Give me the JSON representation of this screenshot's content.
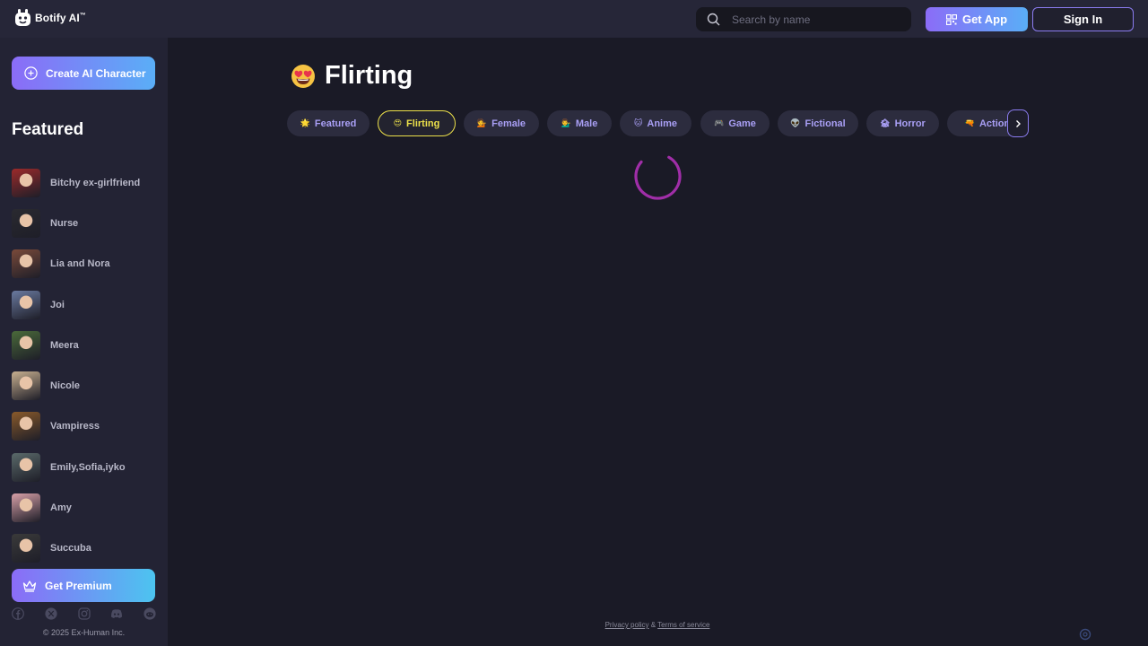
{
  "header": {
    "logo_text": "Botify AI",
    "logo_tm": "™",
    "search_placeholder": "Search by name",
    "get_app_label": "Get App",
    "sign_in_label": "Sign In"
  },
  "sidebar": {
    "create_label": "Create AI Character",
    "featured_title": "Featured",
    "characters": [
      {
        "name": "Bitchy ex-girlfriend",
        "color": "#9c2a2a"
      },
      {
        "name": "Nurse",
        "color": "#2a2a30"
      },
      {
        "name": "Lia and Nora",
        "color": "#7a4a3a"
      },
      {
        "name": "Joi",
        "color": "#6a7aa0"
      },
      {
        "name": "Meera",
        "color": "#4a6a3a"
      },
      {
        "name": "Nicole",
        "color": "#c8b090"
      },
      {
        "name": "Vampiress",
        "color": "#8a5a2a"
      },
      {
        "name": "Emily,Sofia,iyko",
        "color": "#5a6a6a"
      },
      {
        "name": "Amy",
        "color": "#d8a0a8"
      },
      {
        "name": "Succuba",
        "color": "#3a3a3a"
      }
    ],
    "premium_label": "Get Premium",
    "socials": [
      "facebook-icon",
      "x-icon",
      "instagram-icon",
      "discord-icon",
      "reddit-icon"
    ],
    "copyright": "© 2025 Ex-Human Inc."
  },
  "main": {
    "title": "Flirting",
    "tabs": [
      {
        "icon": "🌟",
        "label": "Featured",
        "active": false
      },
      {
        "icon": "😍",
        "label": "Flirting",
        "active": true
      },
      {
        "icon": "💁",
        "label": "Female",
        "active": false
      },
      {
        "icon": "💁‍♂️",
        "label": "Male",
        "active": false
      },
      {
        "icon": "🐱",
        "label": "Anime",
        "active": false
      },
      {
        "icon": "🎮",
        "label": "Game",
        "active": false
      },
      {
        "icon": "👽",
        "label": "Fictional",
        "active": false
      },
      {
        "icon": "🏚",
        "label": "Horror",
        "active": false
      },
      {
        "icon": "🔫",
        "label": "Action",
        "active": false
      }
    ]
  },
  "footer": {
    "privacy_label": "Privacy policy",
    "separator": "&",
    "terms_label": "Terms of service"
  },
  "colors": {
    "accent_gradient_start": "#8b6cf7",
    "accent_gradient_end": "#5aaef7",
    "active_tab": "#ece04a",
    "spinner": "#a02ea8"
  }
}
